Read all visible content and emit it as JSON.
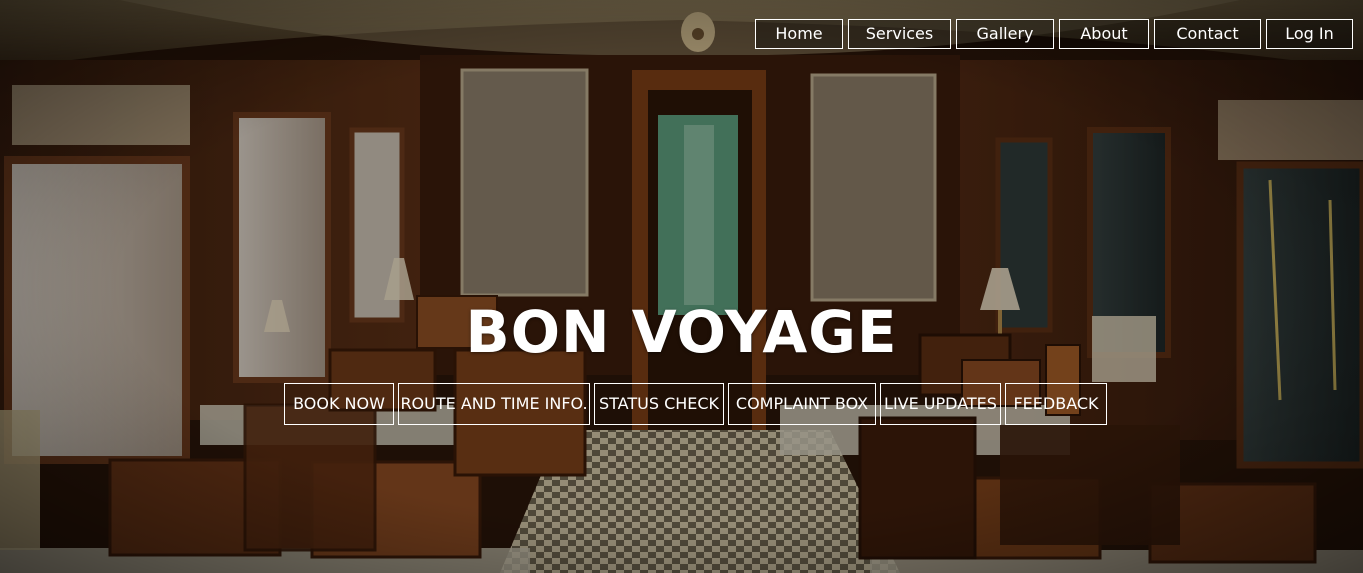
{
  "nav": {
    "items": [
      {
        "label": "Home"
      },
      {
        "label": "Services"
      },
      {
        "label": "Gallery"
      },
      {
        "label": "About"
      },
      {
        "label": "Contact"
      },
      {
        "label": "Log In"
      }
    ]
  },
  "hero": {
    "title": "BON VOYAGE",
    "actions": [
      {
        "label": "BOOK NOW"
      },
      {
        "label": "ROUTE AND TIME INFO."
      },
      {
        "label": "STATUS CHECK"
      },
      {
        "label": "COMPLAINT BOX"
      },
      {
        "label": "LIVE UPDATES"
      },
      {
        "label": "FEEDBACK"
      }
    ]
  },
  "background": {
    "description_icon": "train-dining-car-photo"
  },
  "colors": {
    "text": "#ffffff",
    "border": "#ffffff",
    "wood": "#6b3a1c",
    "dark_overlay": "#1a0f08"
  }
}
